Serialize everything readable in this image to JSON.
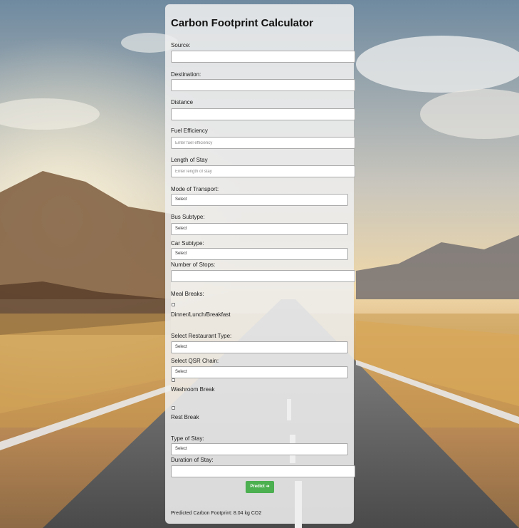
{
  "form": {
    "title": "Carbon Footprint Calculator",
    "source_label": "Source:",
    "source_value": "",
    "destination_label": "Destination:",
    "destination_value": "",
    "distance_label": "Distance",
    "distance_value": "",
    "fuel_efficiency_label": "Fuel Efficiency",
    "fuel_efficiency_placeholder": "Enter fuel efficiency",
    "length_of_stay_label": "Length of Stay",
    "length_of_stay_placeholder": "Enter length of stay",
    "mode_of_transport_label": "Mode of Transport:",
    "mode_of_transport_selected": "Select",
    "bus_subtype_label": "Bus Subtype:",
    "bus_subtype_selected": "Select",
    "car_subtype_label": "Car Subtype:",
    "car_subtype_selected": "Select",
    "number_of_stops_label": "Number of Stops:",
    "number_of_stops_value": "",
    "meal_breaks_label": "Meal Breaks:",
    "meal_option_label": "Dinner/Lunch/Breakfast",
    "meal_option_checked": false,
    "restaurant_type_label": "Select Restaurant Type:",
    "restaurant_type_selected": "Select",
    "qsr_chain_label": "Select QSR Chain:",
    "qsr_chain_selected": "Select",
    "washroom_break_label": "Washroom Break",
    "washroom_break_checked": false,
    "rest_break_label": "Rest Break",
    "rest_break_checked": false,
    "type_of_stay_label": "Type of Stay:",
    "type_of_stay_selected": "Select",
    "duration_of_stay_label": "Duration of Stay:",
    "duration_of_stay_value": "",
    "predict_button_label": "Predict ➔",
    "result_text": "Predicted Carbon Footprint: 8.04 kg CO2"
  },
  "colors": {
    "button": "#4caf50",
    "card": "#eeeeee"
  }
}
